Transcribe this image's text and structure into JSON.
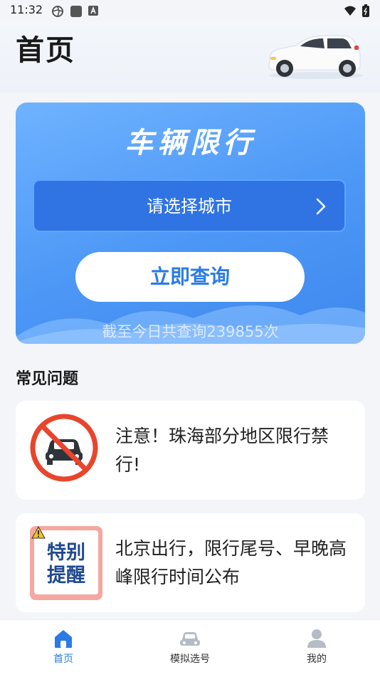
{
  "status_bar": {
    "time": "11:32"
  },
  "page": {
    "title": "首页"
  },
  "hero": {
    "title": "车辆限行",
    "city_placeholder": "请选择城市",
    "query_button": "立即查询",
    "query_count_text": "截至今日共查询239855次"
  },
  "faq": {
    "title": "常见问题",
    "items": [
      {
        "text": "注意！珠海部分地区限行禁行!",
        "icon": "no-car-sign-icon"
      },
      {
        "text": "北京出行，限行尾号、早晚高峰限行时间公布",
        "icon": "special-reminder-badge",
        "badge_line1": "特别",
        "badge_line2": "提醒"
      }
    ]
  },
  "tabs": [
    {
      "label": "首页",
      "icon": "home-icon",
      "active": true
    },
    {
      "label": "模拟选号",
      "icon": "car-icon",
      "active": false
    },
    {
      "label": "我的",
      "icon": "person-icon",
      "active": false
    }
  ],
  "colors": {
    "accent": "#2a7be6",
    "hero_blue": "#4c97f6",
    "inactive": "#9aa3ae"
  }
}
